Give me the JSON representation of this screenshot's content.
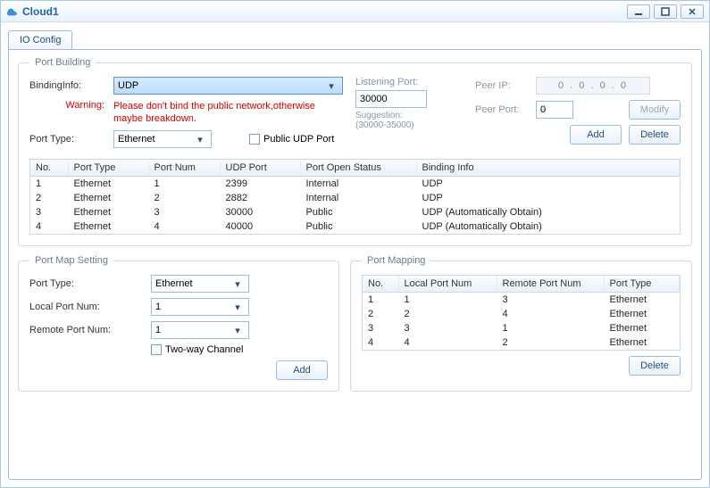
{
  "window": {
    "title": "Cloud1"
  },
  "tabs": {
    "io_config": "IO Config"
  },
  "port_building": {
    "legend": "Port Building",
    "binding_label": "BindingInfo:",
    "binding_value": "UDP",
    "warning_label": "Warning:",
    "warning_text": "Please don't bind the public network,otherwise maybe breakdown.",
    "port_type_label": "Port Type:",
    "port_type_value": "Ethernet",
    "public_udp_label": "Public UDP Port",
    "listening_label": "Listening Port:",
    "listening_value": "30000",
    "suggestion_label": "Suggestion:",
    "suggestion_range": "(30000-35000)",
    "peer_ip_label": "Peer IP:",
    "peer_ip_value": "0  .  0  .  0  .  0",
    "peer_port_label": "Peer Port:",
    "peer_port_value": "0",
    "modify_btn": "Modify",
    "add_btn": "Add",
    "delete_btn": "Delete",
    "headers": {
      "no": "No.",
      "ptype": "Port Type",
      "pnum": "Port Num",
      "udp": "UDP Port",
      "status": "Port Open Status",
      "binfo": "Binding Info"
    },
    "rows": [
      {
        "no": "1",
        "ptype": "Ethernet",
        "pnum": "1",
        "udp": "2399",
        "status": "Internal",
        "binfo": "UDP"
      },
      {
        "no": "2",
        "ptype": "Ethernet",
        "pnum": "2",
        "udp": "2882",
        "status": "Internal",
        "binfo": "UDP"
      },
      {
        "no": "3",
        "ptype": "Ethernet",
        "pnum": "3",
        "udp": "30000",
        "status": "Public",
        "binfo": "UDP (Automatically Obtain)"
      },
      {
        "no": "4",
        "ptype": "Ethernet",
        "pnum": "4",
        "udp": "40000",
        "status": "Public",
        "binfo": "UDP (Automatically Obtain)"
      }
    ]
  },
  "port_map_setting": {
    "legend": "Port Map Setting",
    "port_type_label": "Port Type:",
    "port_type_value": "Ethernet",
    "local_label": "Local Port Num:",
    "local_value": "1",
    "remote_label": "Remote Port Num:",
    "remote_value": "1",
    "twoway_label": "Two-way Channel",
    "add_btn": "Add"
  },
  "port_mapping": {
    "legend": "Port Mapping",
    "headers": {
      "no": "No.",
      "local": "Local Port Num",
      "remote": "Remote Port Num",
      "ptype": "Port Type"
    },
    "rows": [
      {
        "no": "1",
        "local": "1",
        "remote": "3",
        "ptype": "Ethernet"
      },
      {
        "no": "2",
        "local": "2",
        "remote": "4",
        "ptype": "Ethernet"
      },
      {
        "no": "3",
        "local": "3",
        "remote": "1",
        "ptype": "Ethernet"
      },
      {
        "no": "4",
        "local": "4",
        "remote": "2",
        "ptype": "Ethernet"
      }
    ],
    "delete_btn": "Delete"
  }
}
